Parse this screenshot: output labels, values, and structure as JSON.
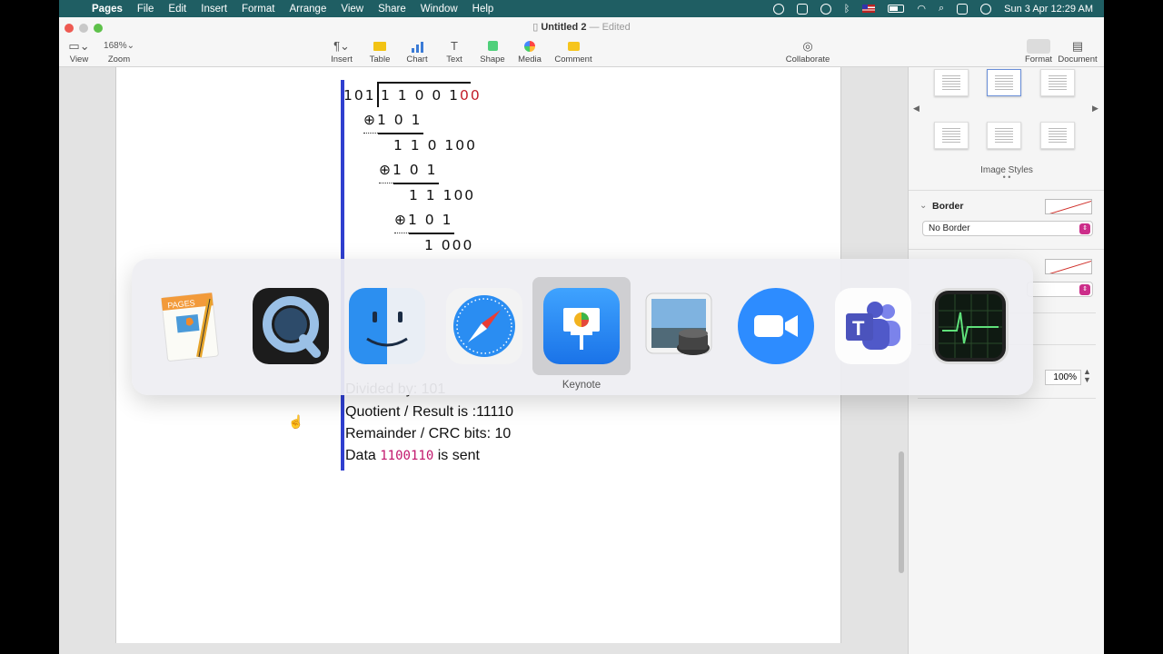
{
  "menubar": {
    "app_name": "Pages",
    "menus": [
      "File",
      "Edit",
      "Insert",
      "Format",
      "Arrange",
      "View",
      "Share",
      "Window",
      "Help"
    ],
    "datetime": "Sun 3 Apr  12:29 AM"
  },
  "window": {
    "doc_title": "Untitled 2",
    "doc_status": "— Edited"
  },
  "toolbar": {
    "view_label": "View",
    "zoom_value": "168%",
    "zoom_label": "Zoom",
    "insert_label": "Insert",
    "table_label": "Table",
    "chart_label": "Chart",
    "text_label": "Text",
    "shape_label": "Shape",
    "media_label": "Media",
    "comment_label": "Comment",
    "collaborate_label": "Collaborate",
    "format_label": "Format",
    "document_label": "Document"
  },
  "division": {
    "divisor": "101",
    "dividend_prefix": "1 1 0 0 1",
    "dividend_padding": "00",
    "steps": [
      {
        "xor": "⊕1 0 1",
        "result": "1 1 0 100"
      },
      {
        "xor": "⊕1 0 1",
        "result": "1 1 100"
      },
      {
        "xor": "⊕1 0 1",
        "result": "1 000"
      }
    ]
  },
  "doc_text": {
    "divided_by": "Divided by: 101",
    "quotient": "Quotient / Result is :11110",
    "remainder": "Remainder / CRC bits: 10",
    "sent_prefix": "Data ",
    "sent_data": "1100110",
    "sent_suffix": " is sent"
  },
  "sidebar": {
    "image_styles_label": "Image Styles",
    "border_label": "Border",
    "border_style": "No Border",
    "opacity_value": "100%"
  },
  "app_switcher": {
    "apps": [
      "Pages",
      "QuickTime Player",
      "Finder",
      "Safari",
      "Keynote",
      "Preview",
      "Zoom",
      "Microsoft Teams",
      "Activity Monitor"
    ],
    "selected_label": "Keynote"
  },
  "colors": {
    "menubar_bg": "#1f5e63",
    "quote_bar": "#2f3fcf",
    "highlight_red": "#c21d2a",
    "code_magenta": "#c2176d"
  }
}
